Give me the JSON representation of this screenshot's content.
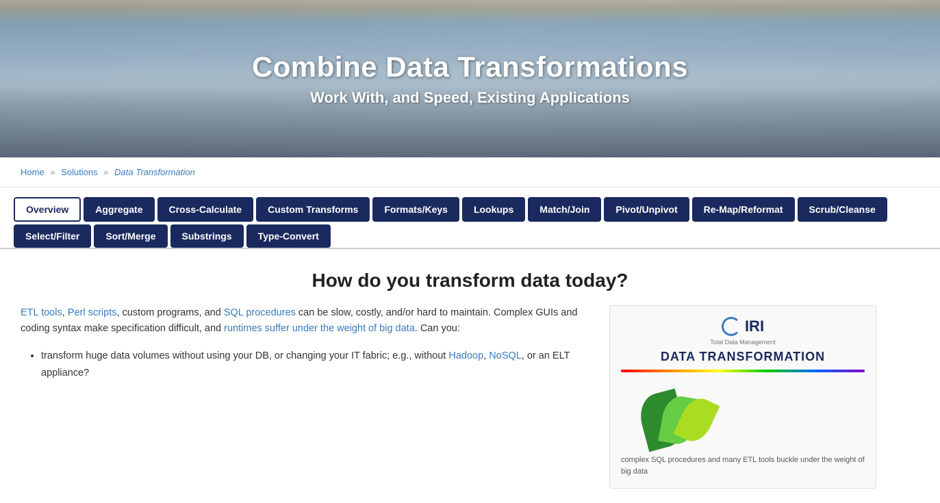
{
  "hero": {
    "title": "Combine Data Transformations",
    "subtitle": "Work With, and Speed, Existing Applications"
  },
  "breadcrumb": {
    "home": "Home",
    "solutions": "Solutions",
    "current": "Data Transformation",
    "sep": "»"
  },
  "tabs": [
    {
      "label": "Overview",
      "active": true
    },
    {
      "label": "Aggregate",
      "active": false
    },
    {
      "label": "Cross-Calculate",
      "active": false
    },
    {
      "label": "Custom Transforms",
      "active": false
    },
    {
      "label": "Formats/Keys",
      "active": false
    },
    {
      "label": "Lookups",
      "active": false
    },
    {
      "label": "Match/Join",
      "active": false
    },
    {
      "label": "Pivot/Unpivot",
      "active": false
    },
    {
      "label": "Re-Map/Reformat",
      "active": false
    },
    {
      "label": "Scrub/Cleanse",
      "active": false
    },
    {
      "label": "Select/Filter",
      "active": false
    },
    {
      "label": "Sort/Merge",
      "active": false
    },
    {
      "label": "Substrings",
      "active": false
    },
    {
      "label": "Type-Convert",
      "active": false
    }
  ],
  "main": {
    "section_heading": "How do you transform data today?",
    "intro_text": "ETL tools, Perl scripts, custom programs, and SQL procedures can be slow, costly, and/or hard to maintain. Complex GUIs and coding syntax make specification difficult, and runtimes suffer under the weight of big data. Can you:",
    "bullets": [
      "transform huge data volumes without using your DB, or changing your IT fabric; e.g., without Hadoop, NoSQL, or an ELT appliance?"
    ],
    "iri": {
      "logo_text": "IRI",
      "logo_subtitle": "Total Data Management",
      "title": "DATA TRANSFORMATION",
      "desc": "complex SQL procedures and many ETL tools buckle under the weight of big data"
    }
  }
}
